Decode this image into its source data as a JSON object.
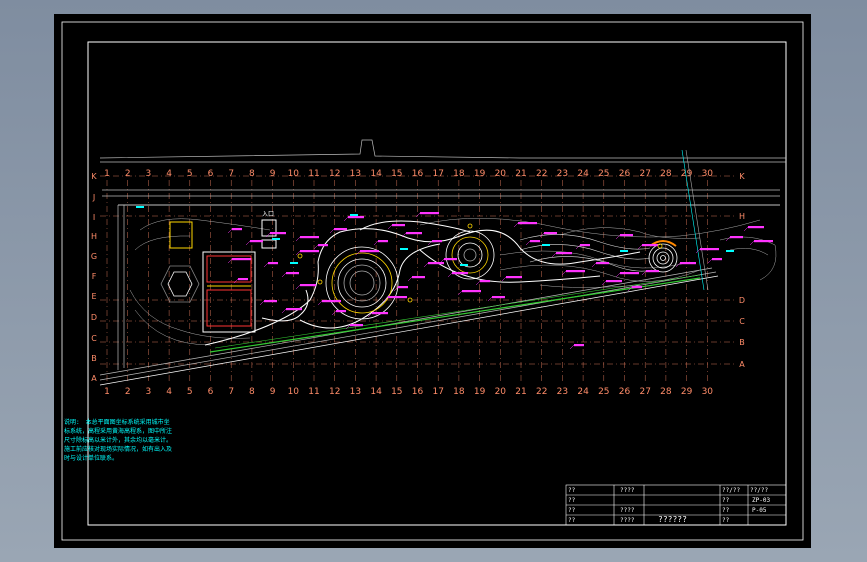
{
  "drawing": {
    "column_labels": [
      "1",
      "2",
      "3",
      "4",
      "5",
      "6",
      "7",
      "8",
      "9",
      "10",
      "11",
      "12",
      "13",
      "14",
      "15",
      "16",
      "17",
      "18",
      "19",
      "20",
      "21",
      "22",
      "23",
      "24",
      "25",
      "26",
      "27",
      "28",
      "29",
      "30"
    ],
    "row_labels_right": [
      "K",
      "H",
      "D",
      "C",
      "B",
      "A"
    ],
    "row_labels_left": [
      "K",
      "J",
      "I",
      "H",
      "G",
      "F",
      "E",
      "D",
      "C",
      "B",
      "A"
    ],
    "entrance_label": "入口",
    "colors": {
      "frame": "#ffffff",
      "grid": "#ff8c69",
      "annotation": "#ff33ff",
      "contour": "#c8c8c8",
      "water": "#00ffff",
      "plaza": "#ffd700",
      "green_edge": "#33cc33",
      "building": "#ff3333"
    }
  },
  "notes": {
    "label": "说明:",
    "text": "本总平面图坐标系统采用城市坐标系统，高程采用黄海高程系，图中所注尺寸除标高以米计外，其余均以毫米计。施工前应核对现场实际情况，如有出入及时与设计单位联系。"
  },
  "title_block": {
    "r1c1": "??",
    "r1c2": "????",
    "r2c1": "??",
    "r2c2": "",
    "r3c1": "??",
    "r3c2": "????",
    "r4c1": "??",
    "r4c2": "????",
    "title": "??????",
    "right_r1a": "??/??",
    "right_r1b": "??/??",
    "right_r2a": "??",
    "right_r2b": "ZP-03",
    "right_r3a": "??",
    "right_r3b": "P-05",
    "right_r4a": "??",
    "right_r4b": ""
  }
}
